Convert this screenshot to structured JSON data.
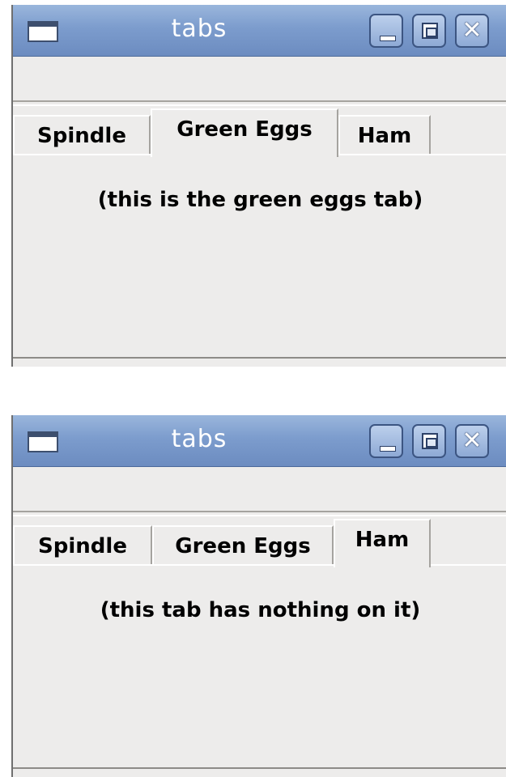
{
  "windows": [
    {
      "title": "tabs",
      "tabs": [
        {
          "label": "Spindle",
          "active": false
        },
        {
          "label": "Green Eggs",
          "active": true
        },
        {
          "label": "Ham",
          "active": false
        }
      ],
      "panel_text": "(this is the green eggs tab)"
    },
    {
      "title": "tabs",
      "tabs": [
        {
          "label": "Spindle",
          "active": false
        },
        {
          "label": "Green Eggs",
          "active": false
        },
        {
          "label": "Ham",
          "active": true
        }
      ],
      "panel_text": "(this tab has nothing on it)"
    }
  ],
  "titlebar_buttons": {
    "minimize_icon": "minimize-icon",
    "maximize_icon": "maximize-icon",
    "close_icon": "close-icon",
    "close_glyph": "✕"
  },
  "colors": {
    "titlebar_top": "#9ab6dc",
    "titlebar_bottom": "#6c8cc0",
    "window_bg": "#edeceb"
  }
}
